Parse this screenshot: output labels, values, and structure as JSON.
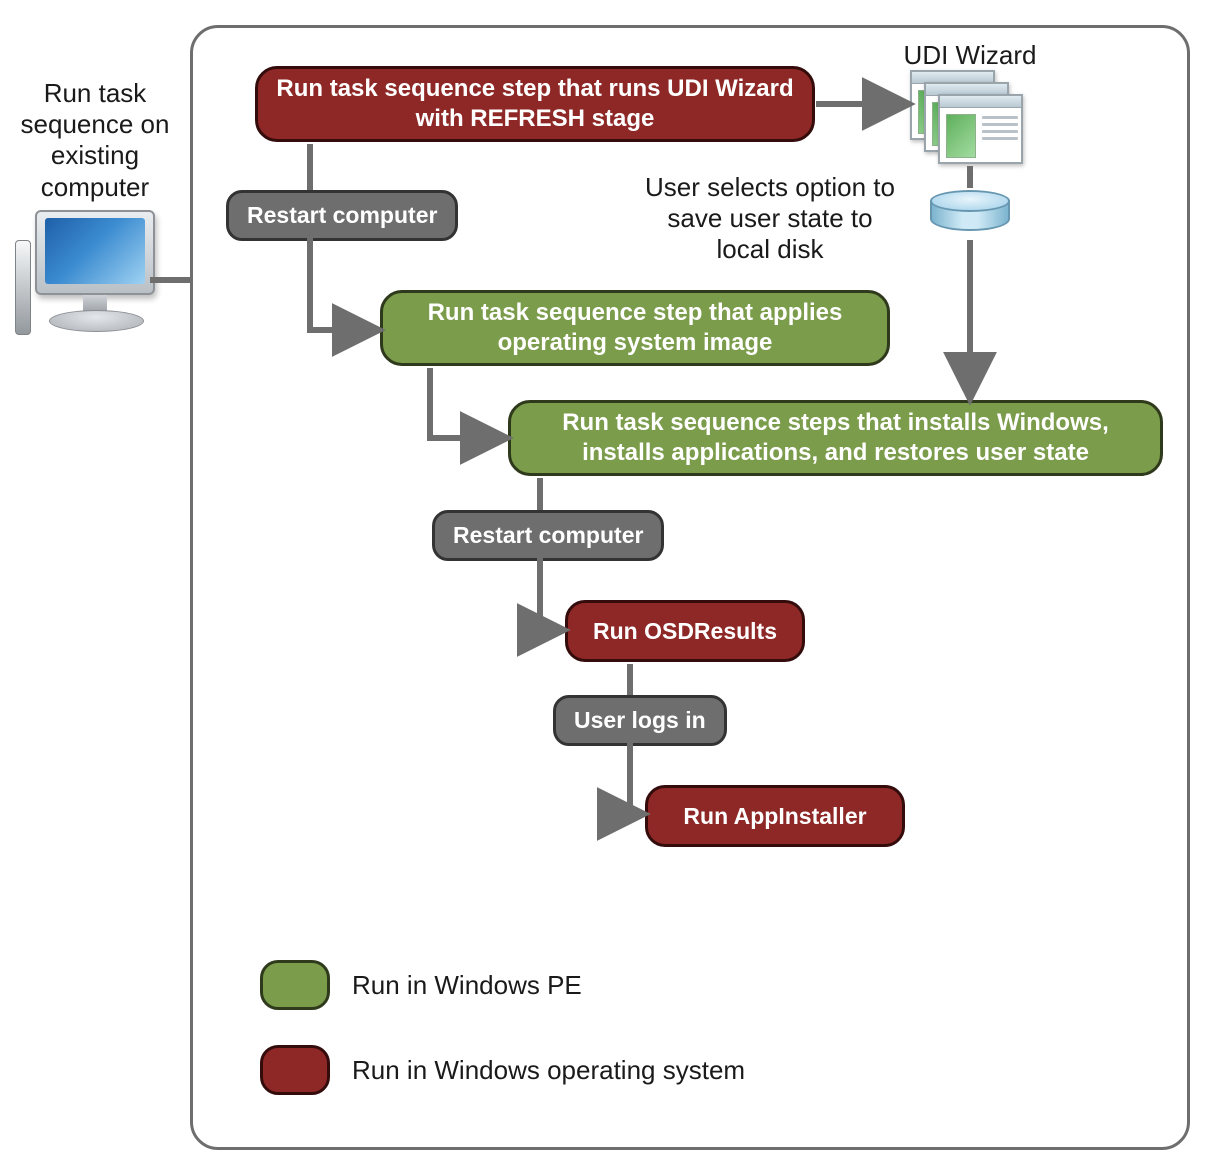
{
  "external_label": "Run task sequence on existing computer",
  "udi_title": "UDI Wizard",
  "option_text": "User selects option to save user state to local disk",
  "nodes": {
    "step1": "Run task sequence step  that runs UDI Wizard with REFRESH  stage",
    "restart1": "Restart computer",
    "step2": "Run  task sequence step that applies operating system image",
    "step3": "Run task sequence steps that installs Windows, installs applications, and restores user state",
    "restart2": "Restart computer",
    "osd": "Run OSDResults",
    "login": "User logs in",
    "appinst": "Run AppInstaller"
  },
  "legend": {
    "pe": "Run in Windows  PE",
    "os": "Run in Windows operating system"
  },
  "icons": {
    "computer": "computer-icon",
    "wizard": "wizard-windows-icon",
    "database": "cylinder-database-icon"
  },
  "colors": {
    "red": "#8e2826",
    "green": "#7b9c4b",
    "grey": "#6e6e6e"
  }
}
